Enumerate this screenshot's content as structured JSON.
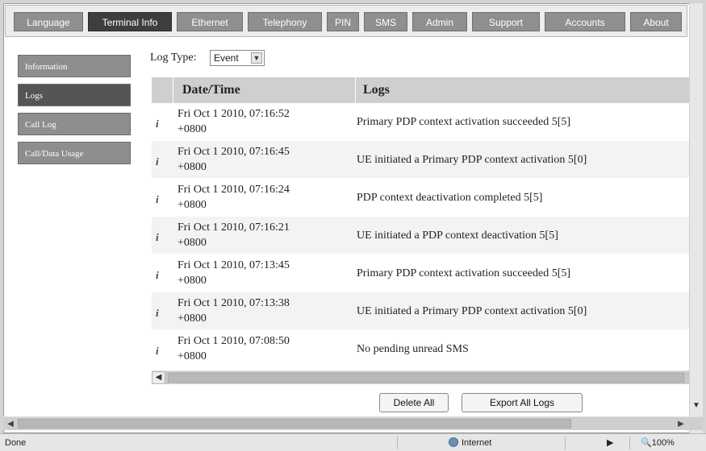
{
  "tabs": [
    {
      "label": "Language",
      "active": false
    },
    {
      "label": "Terminal Info",
      "active": true
    },
    {
      "label": "Ethernet",
      "active": false
    },
    {
      "label": "Telephony",
      "active": false
    },
    {
      "label": "PIN",
      "active": false
    },
    {
      "label": "SMS",
      "active": false
    },
    {
      "label": "Admin",
      "active": false
    },
    {
      "label": "Support",
      "active": false
    },
    {
      "label": "Accounts",
      "active": false
    },
    {
      "label": "About",
      "active": false
    }
  ],
  "sidebar": {
    "items": [
      {
        "label": "Information",
        "active": false
      },
      {
        "label": "Logs",
        "active": true
      },
      {
        "label": "Call Log",
        "active": false
      },
      {
        "label": "Call/Data Usage",
        "active": false
      }
    ]
  },
  "log_type": {
    "label": "Log Type:",
    "selected": "Event"
  },
  "table": {
    "columns": [
      "Date/Time",
      "Logs"
    ],
    "rows": [
      {
        "date": "Fri Oct 1 2010, 07:16:52",
        "tz": "+0800",
        "log": "Primary PDP context activation succeeded 5[5]"
      },
      {
        "date": "Fri Oct 1 2010, 07:16:45",
        "tz": "+0800",
        "log": "UE initiated a Primary PDP context activation 5[0]"
      },
      {
        "date": "Fri Oct 1 2010, 07:16:24",
        "tz": "+0800",
        "log": "PDP context deactivation completed 5[5]"
      },
      {
        "date": "Fri Oct 1 2010, 07:16:21",
        "tz": "+0800",
        "log": "UE initiated a PDP context deactivation 5[5]"
      },
      {
        "date": "Fri Oct 1 2010, 07:13:45",
        "tz": "+0800",
        "log": "Primary PDP context activation succeeded 5[5]"
      },
      {
        "date": "Fri Oct 1 2010, 07:13:38",
        "tz": "+0800",
        "log": "UE initiated a Primary PDP context activation 5[0]"
      },
      {
        "date": "Fri Oct 1 2010, 07:08:50",
        "tz": "+0800",
        "log": "No pending unread SMS"
      }
    ]
  },
  "buttons": {
    "delete_all": "Delete All",
    "export_all": "Export All Logs"
  },
  "status_bar": {
    "left": "Done",
    "zone": "Internet",
    "zoom": "100%"
  }
}
